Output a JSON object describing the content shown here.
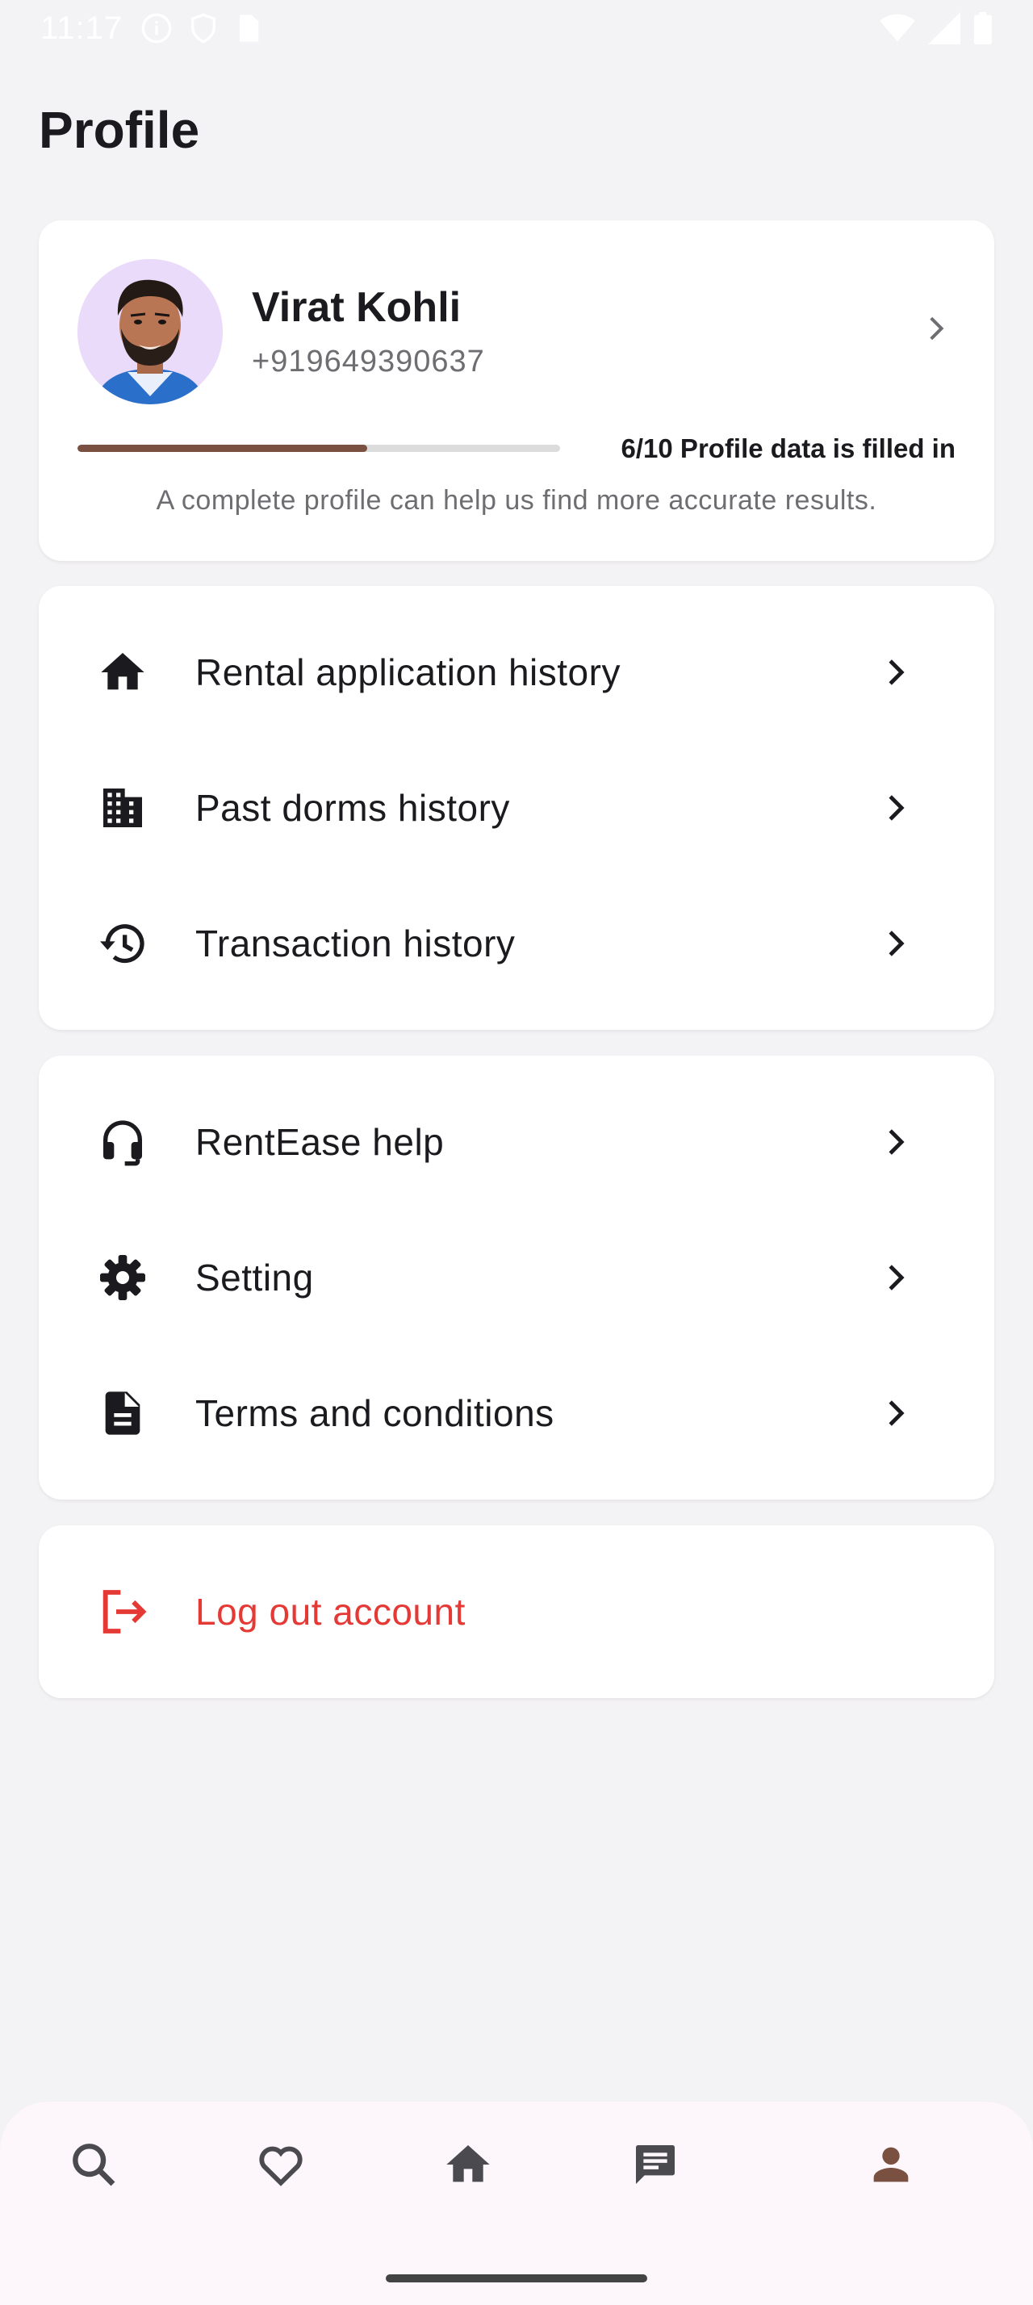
{
  "status_bar": {
    "time": "11:17",
    "icons": [
      "info-icon",
      "shield-icon",
      "sim-card-icon",
      "wifi-icon",
      "signal-icon",
      "battery-icon"
    ]
  },
  "page": {
    "title": "Profile"
  },
  "profile": {
    "name": "Virat Kohli",
    "phone": "+919649390637",
    "progress_label": "6/10 Profile data is filled in",
    "progress_value": 0.6,
    "hint": "A complete profile can help us find more accurate results."
  },
  "menu_group_1": [
    {
      "label": "Rental application history",
      "icon": "home-icon"
    },
    {
      "label": "Past dorms history",
      "icon": "building-icon"
    },
    {
      "label": "Transaction history",
      "icon": "history-icon"
    }
  ],
  "menu_group_2": [
    {
      "label": "RentEase help",
      "icon": "headset-icon"
    },
    {
      "label": "Setting",
      "icon": "gear-icon"
    },
    {
      "label": "Terms and conditions",
      "icon": "document-icon"
    }
  ],
  "logout": {
    "label": "Log out account",
    "icon": "logout-icon",
    "color": "#e53935"
  },
  "bottom_nav": [
    {
      "name": "search",
      "icon": "search-icon"
    },
    {
      "name": "favorites",
      "icon": "heart-icon"
    },
    {
      "name": "home",
      "icon": "home-icon"
    },
    {
      "name": "messages",
      "icon": "chat-icon"
    },
    {
      "name": "profile",
      "icon": "person-icon",
      "active": true
    }
  ],
  "colors": {
    "accent": "#7a5040",
    "danger": "#e53935",
    "background": "#f3f2f4",
    "card": "#ffffff"
  }
}
